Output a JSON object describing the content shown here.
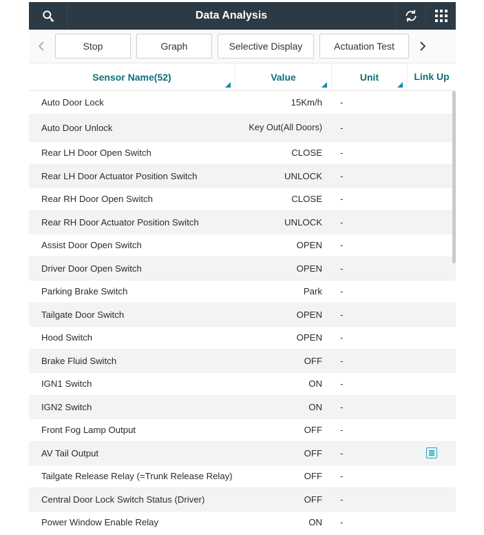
{
  "header": {
    "title": "Data Analysis"
  },
  "toolbar": {
    "stop": "Stop",
    "graph": "Graph",
    "selective": "Selective Display",
    "actuation": "Actuation Test"
  },
  "columns": {
    "sensor": "Sensor Name(52)",
    "value": "Value",
    "unit": "Unit",
    "link": "Link Up"
  },
  "rows": [
    {
      "name": "Auto Door Lock",
      "value": "15Km/h",
      "unit": "-",
      "link": ""
    },
    {
      "name": "Auto Door Unlock",
      "value": "Key Out(All Doors)",
      "unit": "-",
      "link": "",
      "tall": true
    },
    {
      "name": "Rear LH Door Open Switch",
      "value": "CLOSE",
      "unit": "-",
      "link": ""
    },
    {
      "name": "Rear LH Door Actuator Position Switch",
      "value": "UNLOCK",
      "unit": "-",
      "link": ""
    },
    {
      "name": "Rear RH Door Open Switch",
      "value": "CLOSE",
      "unit": "-",
      "link": ""
    },
    {
      "name": "Rear RH Door Actuator Position Switch",
      "value": "UNLOCK",
      "unit": "-",
      "link": ""
    },
    {
      "name": "Assist Door Open Switch",
      "value": "OPEN",
      "unit": "-",
      "link": ""
    },
    {
      "name": "Driver Door Open Switch",
      "value": "OPEN",
      "unit": "-",
      "link": ""
    },
    {
      "name": "Parking Brake Switch",
      "value": "Park",
      "unit": "-",
      "link": ""
    },
    {
      "name": "Tailgate Door Switch",
      "value": "OPEN",
      "unit": "-",
      "link": ""
    },
    {
      "name": "Hood Switch",
      "value": "OPEN",
      "unit": "-",
      "link": ""
    },
    {
      "name": "Brake Fluid Switch",
      "value": "OFF",
      "unit": "-",
      "link": ""
    },
    {
      "name": "IGN1 Switch",
      "value": "ON",
      "unit": "-",
      "link": ""
    },
    {
      "name": "IGN2 Switch",
      "value": "ON",
      "unit": "-",
      "link": ""
    },
    {
      "name": "Front Fog Lamp Output",
      "value": "OFF",
      "unit": "-",
      "link": ""
    },
    {
      "name": "AV Tail Output",
      "value": "OFF",
      "unit": "-",
      "link": "note"
    },
    {
      "name": "Tailgate Release Relay (=Trunk Release Relay)",
      "value": "OFF",
      "unit": "-",
      "link": ""
    },
    {
      "name": "Central Door Lock Switch Status (Driver)",
      "value": "OFF",
      "unit": "-",
      "link": ""
    },
    {
      "name": "Power Window Enable Relay",
      "value": "ON",
      "unit": "-",
      "link": ""
    }
  ]
}
